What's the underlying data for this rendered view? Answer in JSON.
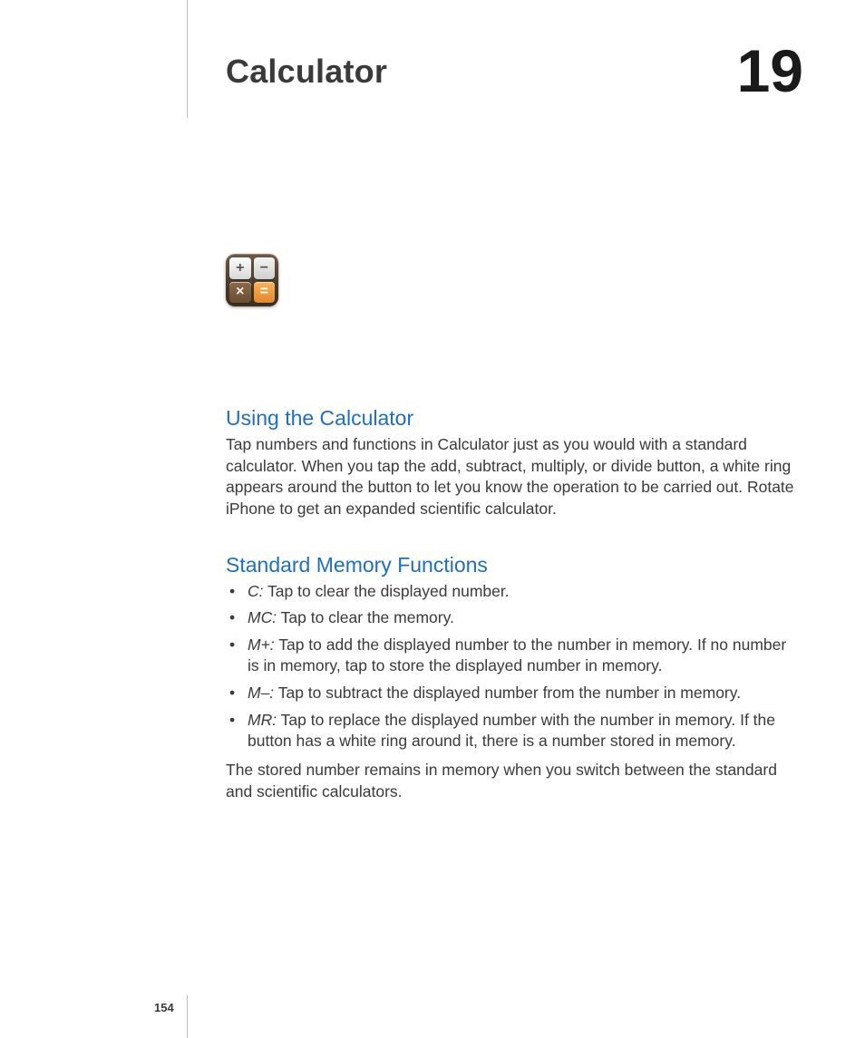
{
  "chapter": {
    "title": "Calculator",
    "number": "19"
  },
  "page_number": "154",
  "icon": {
    "name": "calculator-icon",
    "keys": [
      "+",
      "−",
      "×",
      "="
    ]
  },
  "sections": {
    "using": {
      "heading": "Using the Calculator",
      "body": "Tap numbers and functions in Calculator just as you would with a standard calculator. When you tap the add, subtract, multiply, or divide button, a white ring appears around the button to let you know the operation to be carried out. Rotate iPhone to get an expanded scientific calculator."
    },
    "memory": {
      "heading": "Standard Memory Functions",
      "items": [
        {
          "term": "C:",
          "desc": "Tap to clear the displayed number."
        },
        {
          "term": "MC:",
          "desc": "Tap to clear the memory."
        },
        {
          "term": "M+:",
          "desc": "Tap to add the displayed number to the number in memory. If no number is in memory, tap to store the displayed number in memory."
        },
        {
          "term": "M–:",
          "desc": "Tap to subtract the displayed number from the number in memory."
        },
        {
          "term": "MR:",
          "desc": "Tap to replace the displayed number with the number in memory. If the button has a white ring around it, there is a number stored in memory."
        }
      ],
      "footnote": "The stored number remains in memory when you switch between the standard and scientific calculators."
    }
  }
}
